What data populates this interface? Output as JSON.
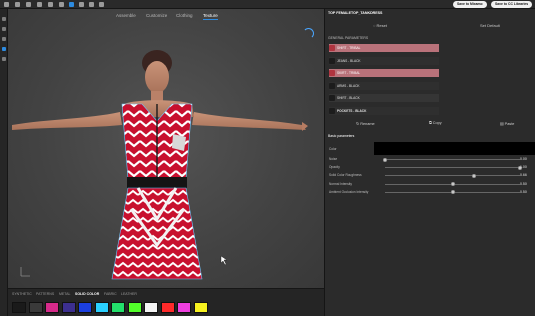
{
  "toolbar": {
    "save_to_mixamo": "Save to Mixamo",
    "save_to_library": "Save to CC Libraries"
  },
  "viewport": {
    "tabs": [
      {
        "label": "Assemble"
      },
      {
        "label": "Customize"
      },
      {
        "label": "Clothing"
      },
      {
        "label": "Texture"
      }
    ],
    "active_tab": "Texture"
  },
  "bottom_strip": {
    "tabs": [
      {
        "label": "SYNTHETIC"
      },
      {
        "label": "PATTERNS"
      },
      {
        "label": "METAL"
      },
      {
        "label": "SOLID COLOR"
      },
      {
        "label": "FABRIC"
      },
      {
        "label": "LEATHER"
      }
    ],
    "active_tab": "SOLID COLOR",
    "swatches": [
      "#1a1a1a",
      "#3a3a3a",
      "#d62a8a",
      "#3c2f8f",
      "#1b3fe0",
      "#2ad0ff",
      "#23e06b",
      "#52ff2a",
      "#f4f4f4",
      "#ff2a2a",
      "#f03fe0",
      "#f7f21f"
    ]
  },
  "panel": {
    "title": "TOP FEMALETOP_TANKDRESS",
    "reset_label": "Reset",
    "set_default_label": "Set Default",
    "general_section": "GENERAL PARAMETERS",
    "materials": [
      {
        "label": "SHIRT - TRIBAL",
        "color": "#b0343f"
      },
      {
        "label": "JEANS - BLACK",
        "color": "#1c1c1c"
      },
      {
        "label": "SKIRT - TRIBAL",
        "color": "#b0343f"
      },
      {
        "label": "ARMS - BLACK",
        "color": "#1c1c1c"
      },
      {
        "label": "SHIRT - BLACK",
        "color": "#1c1c1c"
      },
      {
        "label": "POCKETS - BLACK",
        "color": "#1c1c1c"
      }
    ],
    "actions": {
      "rename": "Rename",
      "copy": "Copy",
      "paste": "Paste"
    },
    "basic_section": "Basic parameters",
    "color_label": "Color",
    "color_value": "#000000",
    "sliders": [
      {
        "label": "Noise",
        "value": "0.00",
        "fraction": 0.0
      },
      {
        "label": "Opacity",
        "value": "1.00",
        "fraction": 1.0
      },
      {
        "label": "Solid Color Roughness",
        "value": "0.66",
        "fraction": 0.66
      },
      {
        "label": "Normal Intensity",
        "value": "0.50",
        "fraction": 0.5
      },
      {
        "label": "Ambient Occlusion Intensity",
        "value": "0.50",
        "fraction": 0.5
      }
    ]
  }
}
